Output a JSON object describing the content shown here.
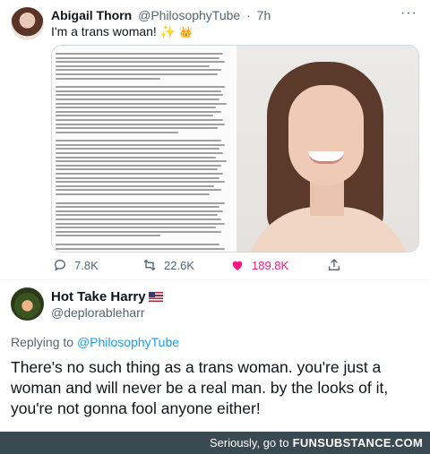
{
  "tweet": {
    "author_name": "Abigail Thorn",
    "author_handle": "@PhilosophyTube",
    "time": "7h",
    "separator": "·",
    "more": "···",
    "text": "I'm a trans woman!",
    "emoji_sparkles": "✨",
    "emoji_crown": "👑",
    "stats": {
      "replies": "7.8K",
      "retweets": "22.6K",
      "likes": "189.8K"
    },
    "colors": {
      "like": "#f91880",
      "muted": "#536471"
    }
  },
  "reply": {
    "author_name": "Hot Take Harry",
    "author_handle": "@deplorableharr",
    "replying_prefix": "Replying to",
    "replying_to": "@PhilosophyTube",
    "text": "There's no such thing as a trans woman. you're just a woman and will never be a real man. by the looks of it, you're not gonna fool anyone either!",
    "colors": {
      "link": "#1d9bf0"
    }
  },
  "footer": {
    "text": "Seriously, go to",
    "brand": "FUNSUBSTANCE.COM",
    "background": "#3a4a52"
  }
}
